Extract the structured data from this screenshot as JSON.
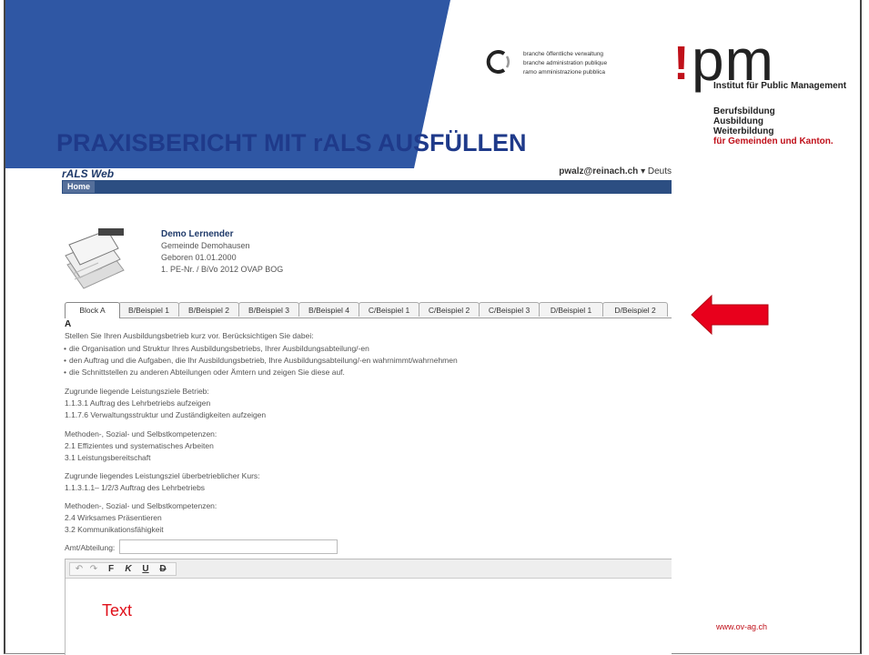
{
  "colors": {
    "title_blue": "#1f3a8a",
    "banner_blue": "#2f57a4",
    "ipm_red": "#c0101a",
    "navbar_blue": "#2c4e82",
    "arrow_red": "#e8001c"
  },
  "branche": {
    "icon": "circle-arc-logo-icon",
    "lines": [
      "branche öffentliche verwaltung",
      "branche administration publique",
      "ramo amministrazione pubblica"
    ]
  },
  "ipm": {
    "logo_exclaim": "!",
    "logo_letters": "pm",
    "subtitle": "Institut für Public Management",
    "list": [
      "Berufsbildung",
      "Ausbildung",
      "Weiterbildung"
    ],
    "list_red": "für Gemeinden und Kanton."
  },
  "slide": {
    "title": "PRAXISBERICHT MIT rALS AUSFÜLLEN",
    "footer_url": "www.ov-ag.ch"
  },
  "app": {
    "title": "rALS Web",
    "user_email": "pwalz@reinach.ch",
    "language": "▾ Deuts",
    "nav": {
      "home": "Home"
    }
  },
  "profile": {
    "name": "Demo Lernender",
    "lines": [
      "Gemeinde Demohausen",
      "Geboren 01.01.2000",
      "1. PE-Nr. / BiVo 2012 OVAP BOG"
    ]
  },
  "tabs": [
    {
      "label": "Block A",
      "active": true
    },
    {
      "label": "B/Beispiel 1",
      "active": false
    },
    {
      "label": "B/Beispiel 2",
      "active": false
    },
    {
      "label": "B/Beispiel 3",
      "active": false
    },
    {
      "label": "B/Beispiel 4",
      "active": false
    },
    {
      "label": "C/Beispiel 1",
      "active": false
    },
    {
      "label": "C/Beispiel 2",
      "active": false
    },
    {
      "label": "C/Beispiel 3",
      "active": false
    },
    {
      "label": "D/Beispiel 1",
      "active": false
    },
    {
      "label": "D/Beispiel 2",
      "active": false
    }
  ],
  "content": {
    "heading": "A",
    "intro": "Stellen Sie Ihren Ausbildungsbetrieb kurz vor. Berücksichtigen Sie dabei:",
    "bullets": [
      "die Organisation und Struktur Ihres Ausbildungsbetriebs, Ihrer Ausbildungsabteilung/-en",
      "den Auftrag und die Aufgaben, die Ihr Ausbildungsbetrieb, Ihre Ausbildungsabteilung/-en wahrnimmt/wahrnehmen",
      "die Schnittstellen zu anderen Abteilungen oder Ämtern und zeigen Sie diese auf."
    ],
    "sections": [
      {
        "heading": "Zugrunde liegende Leistungsziele Betrieb:",
        "items": [
          "1.1.3.1 Auftrag des Lehrbetriebs aufzeigen",
          "1.1.7.6 Verwaltungsstruktur und Zuständigkeiten aufzeigen"
        ]
      },
      {
        "heading": "Methoden-, Sozial- und Selbstkompetenzen:",
        "items": [
          "2.1 Effizientes und systematisches Arbeiten",
          "3.1 Leistungsbereitschaft"
        ]
      },
      {
        "heading": "Zugrunde liegendes Leistungsziel überbetrieblicher Kurs:",
        "items": [
          "1.1.3.1.1– 1/2/3 Auftrag des Lehrbetriebs"
        ]
      },
      {
        "heading": "Methoden-, Sozial- und Selbstkompetenzen:",
        "items": [
          "2.4 Wirksames Präsentieren",
          "3.2 Kommunikationsfähigkeit"
        ]
      }
    ],
    "amt_label": "Amt/Abteilung:",
    "amt_value": ""
  },
  "editor": {
    "toolbar": [
      {
        "icon": "undo-icon",
        "glyph": "↶"
      },
      {
        "icon": "redo-icon",
        "glyph": "↷"
      },
      {
        "icon": "bold-icon",
        "glyph": "F"
      },
      {
        "icon": "italic-icon",
        "glyph": "K"
      },
      {
        "icon": "underline-icon",
        "glyph": "U"
      },
      {
        "icon": "strikethrough-icon",
        "glyph": "D"
      }
    ],
    "text": "Text"
  },
  "annotation": {
    "icon": "red-arrow-left-icon"
  }
}
